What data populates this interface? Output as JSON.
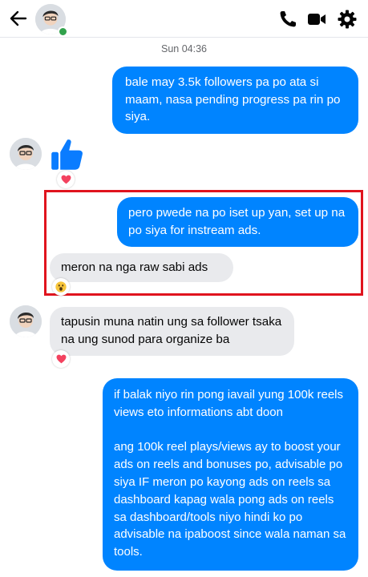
{
  "header": {
    "back_icon": "arrow-left-icon",
    "contact_online": true,
    "actions": [
      "phone-icon",
      "video-camera-icon",
      "gear-icon"
    ],
    "accent_color": "#0084ff"
  },
  "conversation": {
    "timestamp": "Sun 04:36",
    "messages": [
      {
        "from": "me",
        "text": "bale may 3.5k followers pa po ata si maam, nasa pending progress pa rin po siya."
      },
      {
        "from": "contact",
        "type": "like-sticker",
        "reaction": "heart"
      },
      {
        "from": "me",
        "text": "pero pwede na po iset up yan, set up na po siya for instream ads."
      },
      {
        "from": "contact",
        "text": "meron na nga raw sabi ads",
        "reaction": "wow"
      },
      {
        "from": "contact",
        "text": "tapusin muna natin ung sa follower tsaka na ung sunod para organize ba",
        "reaction": "heart"
      },
      {
        "from": "me",
        "text": "if balak niyo rin pong iavail yung 100k reels views eto informations abt doon\n\nang 100k reel plays/views ay to boost your ads on reels and bonuses po, advisable po siya IF meron po kayong ads on reels sa dashboard kapag wala pong ads on reels sa dashboard/tools niyo hindi ko po advisable na ipaboost since wala naman sa tools."
      }
    ]
  }
}
